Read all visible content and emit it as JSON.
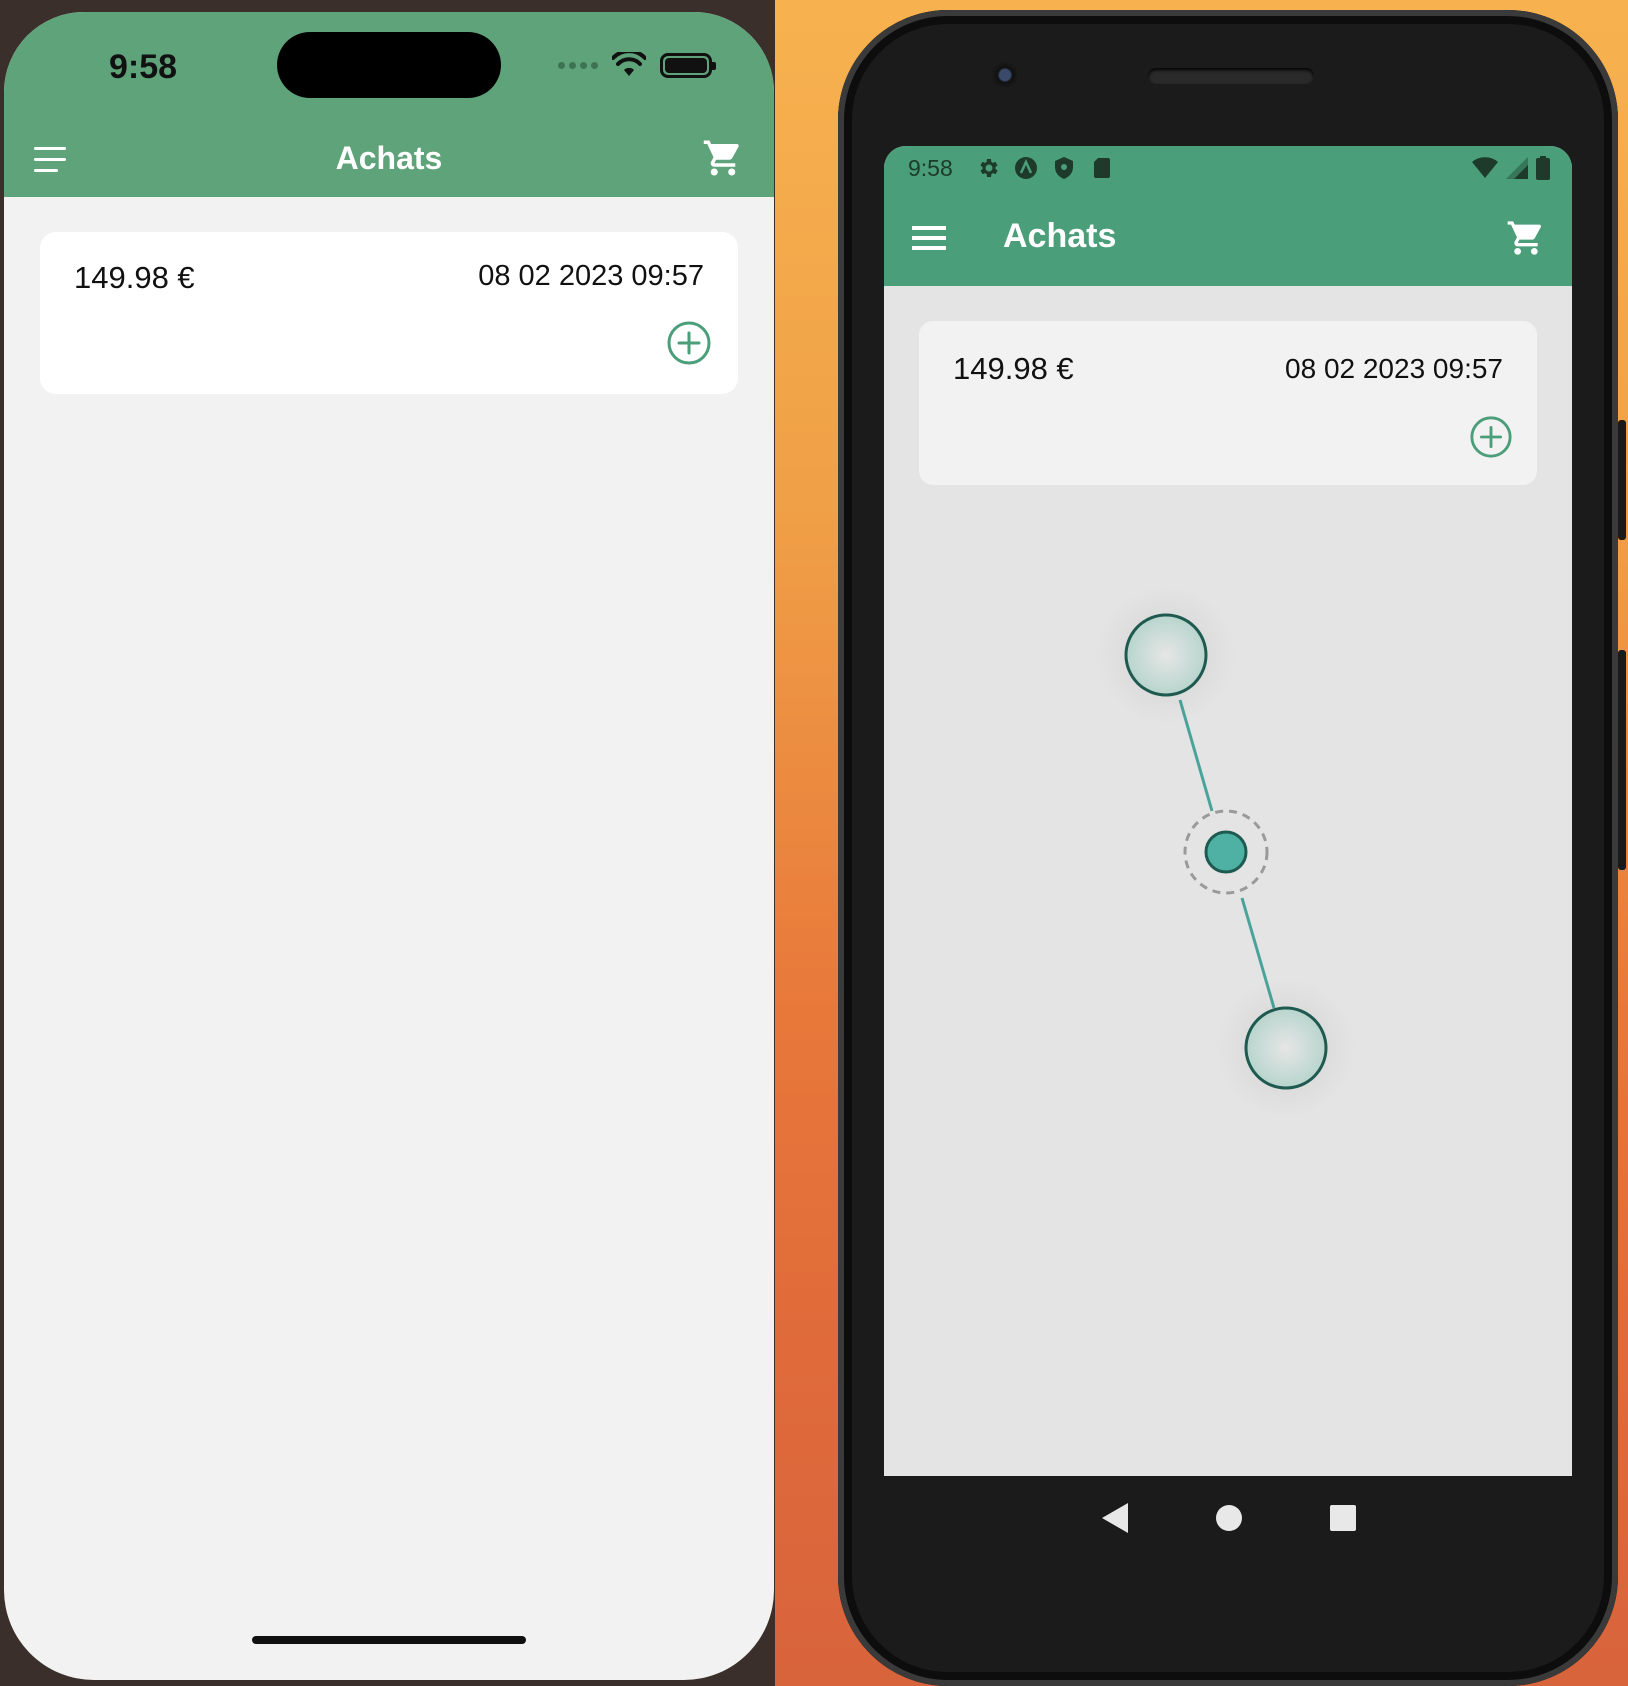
{
  "ios": {
    "status_time": "9:58",
    "title": "Achats",
    "card": {
      "amount": "149.98 €",
      "date": "08 02 2023 09:57"
    }
  },
  "android": {
    "status_time": "9:58",
    "title": "Achats",
    "card": {
      "amount": "149.98 €",
      "date": "08 02 2023 09:57"
    }
  },
  "colors": {
    "ios_header": "#5fa37a",
    "android_header": "#4a9e79",
    "accent": "#4a9e79"
  },
  "icons": [
    "menu-icon",
    "cart-icon",
    "add-circle-icon",
    "wifi-icon",
    "battery-icon",
    "settings-icon",
    "back-icon",
    "home-icon",
    "recents-icon"
  ]
}
